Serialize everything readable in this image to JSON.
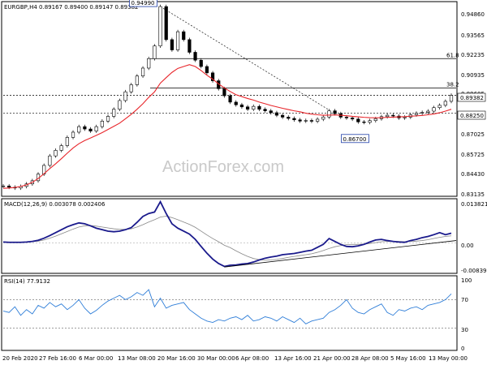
{
  "chart_data": [
    {
      "type": "candlestick",
      "title": "EURGBP,H4  0.89167 0.89400 0.89147 0.89382",
      "ylim": [
        0.831,
        0.952
      ],
      "y_ticks": [
        "0.94860",
        "0.93565",
        "0.92235",
        "0.90935",
        "0.89605",
        "0.87025",
        "0.85725",
        "0.84430",
        "0.83135"
      ],
      "x_ticks": [
        "20 Feb 2020",
        "27 Feb 16:00",
        "6 Mar 00:00",
        "13 Mar 08:00",
        "20 Mar 16:00",
        "30 Mar 00:00",
        "6 Apr 08:00",
        "13 Apr 16:00",
        "21 Apr 00:00",
        "28 Apr 08:00",
        "5 May 16:00",
        "13 May 00:00"
      ],
      "series": [
        {
          "name": "price",
          "values": [
            0.8365,
            0.8357,
            0.8352,
            0.8362,
            0.8378,
            0.8398,
            0.844,
            0.8495,
            0.8555,
            0.859,
            0.862,
            0.8672,
            0.8705,
            0.874,
            0.8725,
            0.8712,
            0.874,
            0.8775,
            0.8805,
            0.885,
            0.8905,
            0.896,
            0.9005,
            0.906,
            0.911,
            0.917,
            0.925,
            0.9499,
            0.929,
            0.9225,
            0.934,
            0.929,
            0.921,
            0.916,
            0.912,
            0.908,
            0.903,
            0.898,
            0.8935,
            0.8895,
            0.8878,
            0.8865,
            0.885,
            0.8868,
            0.885,
            0.884,
            0.8828,
            0.8812,
            0.88,
            0.8792,
            0.8783,
            0.8775,
            0.8779,
            0.8774,
            0.8787,
            0.8801,
            0.884,
            0.8822,
            0.88,
            0.8795,
            0.8788,
            0.877,
            0.8767,
            0.8778,
            0.879,
            0.8803,
            0.8812,
            0.8807,
            0.8795,
            0.88,
            0.8815,
            0.8825,
            0.883,
            0.8838,
            0.886,
            0.8875,
            0.89,
            0.8938
          ]
        },
        {
          "name": "ma",
          "values": [
            0.835,
            0.8352,
            0.8356,
            0.8362,
            0.8372,
            0.8388,
            0.8412,
            0.8442,
            0.8475,
            0.8505,
            0.8538,
            0.8572,
            0.8605,
            0.8632,
            0.8652,
            0.8668,
            0.8685,
            0.8702,
            0.8722,
            0.8742,
            0.8762,
            0.879,
            0.8818,
            0.885,
            0.8885,
            0.8925,
            0.896,
            0.9015,
            0.905,
            0.9083,
            0.9108,
            0.912,
            0.9132,
            0.912,
            0.9095,
            0.9065,
            0.904,
            0.901,
            0.8985,
            0.8962,
            0.8942,
            0.893,
            0.8918,
            0.8908,
            0.8895,
            0.8885,
            0.8874,
            0.8865,
            0.8856,
            0.8848,
            0.884,
            0.8834,
            0.8825,
            0.8819,
            0.8815,
            0.8812,
            0.8813,
            0.8814,
            0.8812,
            0.8809,
            0.8805,
            0.8802,
            0.8799,
            0.8797,
            0.8796,
            0.8797,
            0.8799,
            0.88,
            0.8802,
            0.8803,
            0.8806,
            0.8808,
            0.8811,
            0.8815,
            0.882,
            0.8828,
            0.8838,
            0.885
          ]
        }
      ],
      "levels": [
        {
          "label": "61.8",
          "value": 0.917
        },
        {
          "label": "38.2",
          "value": 0.8985
        },
        {
          "label": "",
          "value": 0.8938
        },
        {
          "label": "",
          "value": 0.8825
        }
      ],
      "annotations": [
        {
          "text": "0.94990",
          "value": 0.9499
        },
        {
          "text": "0.86700",
          "value": 0.867
        }
      ],
      "markers": [
        "0.89382",
        "0.88250"
      ],
      "watermark": "ActionForex.com"
    },
    {
      "type": "line",
      "title": "MACD(12,26,9) 0.003078 0.002406",
      "ylim": [
        -0.0098,
        0.0142
      ],
      "y_ticks": [
        "0.013821",
        "0.00",
        "-0.008397"
      ],
      "series": [
        {
          "name": "macd",
          "values": [
            0.0003,
            0.0002,
            0.0002,
            0.0002,
            0.0003,
            0.0005,
            0.0009,
            0.0016,
            0.0025,
            0.0035,
            0.0045,
            0.0055,
            0.0062,
            0.0068,
            0.0065,
            0.0058,
            0.005,
            0.0045,
            0.004,
            0.0038,
            0.004,
            0.0045,
            0.0052,
            0.007,
            0.009,
            0.01,
            0.0105,
            0.014,
            0.01,
            0.0065,
            0.005,
            0.004,
            0.003,
            0.0012,
            -0.0012,
            -0.0035,
            -0.0055,
            -0.007,
            -0.008,
            -0.0076,
            -0.0075,
            -0.0072,
            -0.007,
            -0.0065,
            -0.0058,
            -0.0052,
            -0.0048,
            -0.0045,
            -0.004,
            -0.0038,
            -0.0036,
            -0.0032,
            -0.0028,
            -0.0025,
            -0.0015,
            -0.0005,
            0.0015,
            0.0005,
            -0.0005,
            -0.0012,
            -0.0013,
            -0.001,
            -0.0005,
            0.0003,
            0.001,
            0.0012,
            0.0008,
            0.0005,
            0.0003,
            0.0002,
            0.0008,
            0.0012,
            0.0018,
            0.0022,
            0.0028,
            0.0035,
            0.0028,
            0.0033
          ]
        },
        {
          "name": "signal",
          "values": [
            0.0003,
            0.0003,
            0.0003,
            0.0003,
            0.0003,
            0.0004,
            0.0006,
            0.001,
            0.0016,
            0.0023,
            0.0031,
            0.0039,
            0.0047,
            0.0054,
            0.0058,
            0.0059,
            0.0057,
            0.0054,
            0.0051,
            0.0048,
            0.0046,
            0.0046,
            0.0048,
            0.0054,
            0.0062,
            0.0071,
            0.0079,
            0.0088,
            0.0091,
            0.0086,
            0.0079,
            0.0071,
            0.0063,
            0.0053,
            0.004,
            0.0027,
            0.0015,
            0.0004,
            -0.0008,
            -0.0016,
            -0.0027,
            -0.0037,
            -0.0046,
            -0.0053,
            -0.0057,
            -0.0059,
            -0.0058,
            -0.0056,
            -0.0053,
            -0.0049,
            -0.0046,
            -0.0043,
            -0.004,
            -0.0037,
            -0.0032,
            -0.0026,
            -0.0019,
            -0.0013,
            -0.0009,
            -0.0006,
            -0.0005,
            -0.0005,
            -0.0004,
            -0.0002,
            0.0001,
            0.0004,
            0.0005,
            0.0005,
            0.0005,
            0.0004,
            0.0005,
            0.0006,
            0.0008,
            0.0011,
            0.0015,
            0.0019,
            0.0022,
            0.0024
          ]
        }
      ],
      "trendline": [
        -0.0082,
        0.0008
      ]
    },
    {
      "type": "line",
      "title": "RSI(14) 77.9132",
      "ylim": [
        0,
        100
      ],
      "y_ticks": [
        "100",
        "70",
        "30",
        "0"
      ],
      "levels": [
        70,
        30
      ],
      "series": [
        {
          "name": "rsi",
          "values": [
            54,
            52,
            60,
            48,
            56,
            50,
            62,
            58,
            66,
            60,
            64,
            56,
            62,
            70,
            58,
            50,
            55,
            62,
            68,
            72,
            76,
            70,
            74,
            80,
            76,
            84,
            60,
            72,
            58,
            62,
            64,
            66,
            56,
            50,
            44,
            40,
            38,
            42,
            40,
            44,
            46,
            42,
            48,
            40,
            42,
            46,
            44,
            40,
            46,
            42,
            38,
            44,
            36,
            40,
            42,
            44,
            52,
            56,
            62,
            70,
            58,
            52,
            50,
            56,
            60,
            64,
            52,
            48,
            56,
            54,
            58,
            60,
            56,
            62,
            64,
            66,
            70,
            78
          ]
        }
      ]
    }
  ]
}
